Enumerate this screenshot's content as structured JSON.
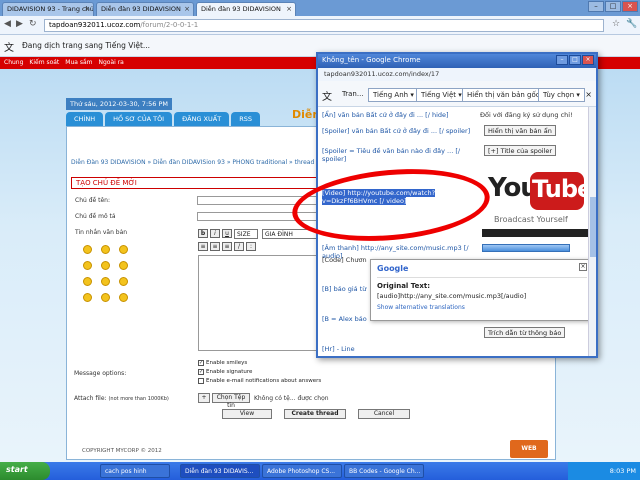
{
  "browser": {
    "tabs": [
      {
        "label": "DIDAVISION 93 - Trang chủ"
      },
      {
        "label": "Diễn đàn 93 DIDAVISION"
      },
      {
        "label": "Diễn đàn 93 DIDAVISION"
      }
    ],
    "url_host": "tapdoan932011.ucoz.com",
    "url_path": "/forum/2-0-0-1-1",
    "translate_message": "Đang dịch trang sang Tiếng Việt...",
    "bookmarks": [
      "Chung",
      "Kiếm soát",
      "Mua sắm",
      "Ngoài ra"
    ]
  },
  "forum": {
    "date": "Thứ sáu, 2012-03-30, 7:56 PM",
    "nav": [
      "CHÍNH",
      "HỒ SƠ CỦA TÔI",
      "ĐĂNG XUẤT",
      "RSS"
    ],
    "brand": "Diễn",
    "breadcrumb": "Diễn Đàn 93 DIDAVISION » Diễn đàn DIDAVISion 93 » PHONG traditional » thread",
    "new_topic": "TẠO CHỦ ĐỀ MỚI",
    "label_title": "Chủ đề tên:",
    "label_desc": "Chủ đề mô tả",
    "label_message": "Tin nhắn văn bản",
    "editor_size": "SIZE",
    "editor_font": "GIA ĐÌNH",
    "message_options": "Message options:",
    "opt_smileys": "Enable smileys",
    "opt_signature": "Enable signature",
    "opt_email": "Enable e-mail notifications about answers",
    "attach_label": "Attach file:",
    "attach_note": "(not more than 1000Kb)",
    "choose_file": "Chọn Tệp tin",
    "no_file": "Không có tệ... được chọn",
    "btn_view": "View",
    "btn_create": "Create thread",
    "btn_cancel": "Cancel",
    "copyright": "COPYRIGHT MYCORP © 2012",
    "logo_text": "WEB"
  },
  "popup": {
    "title": "Không_tên - Google Chrome",
    "url": "tapdoan932011.ucoz.com/index/17",
    "translate_btn": "Tran...",
    "lang_from": "Tiếng Anh",
    "lang_to": "Tiếng Việt",
    "show_original": "Hiển thị văn bản gốc",
    "options": "Tùy chọn",
    "rows": {
      "hide": "[Ẩn] văn bản Bất cứ ở đây đi ... [/ hide]",
      "hide_right": "Đối với đăng ký sử dụng chỉ!",
      "spoiler1": "[Spoiler] văn bản Bất cứ ở đây đi ... [/ spoiler]",
      "spoiler1_btn": "Hiển thị văn bản ẩn",
      "spoiler2": "[Spoiler = Tiêu đề văn bản nào đi đây ... [/ spoiler]",
      "spoiler2_btn": "[+] Title của spoiler",
      "video": "[Video] http://youtube.com/watch?v=DkzFf6BHVmc [/ video]",
      "audio": "[Âm thanh] http://any_site.com/music.mp3 [/ audio]",
      "code": "[Code] Chươn",
      "b": "[B] báo giá từ",
      "b_alex": "[B = Alex báo",
      "quote_btn": "Trích dẫn từ thông báo",
      "hr": "[Hr] - Line"
    },
    "youtube": {
      "you": "You",
      "tube": "Tube",
      "tagline": "Broadcast Yourself"
    },
    "google_popup": {
      "logo": "Google",
      "original_label": "Original Text:",
      "original_text": "[audio]http://any_site.com/music.mp3[/audio]",
      "alt": "Show alternative translations"
    }
  },
  "taskbar": {
    "start": "start",
    "tasks": [
      "cach pos hinh",
      "Diễn đàn 93 DIDAVIS...",
      "Adobe Photoshop CS...",
      "BB Codes - Google Ch..."
    ],
    "clock": "8:03 PM"
  }
}
